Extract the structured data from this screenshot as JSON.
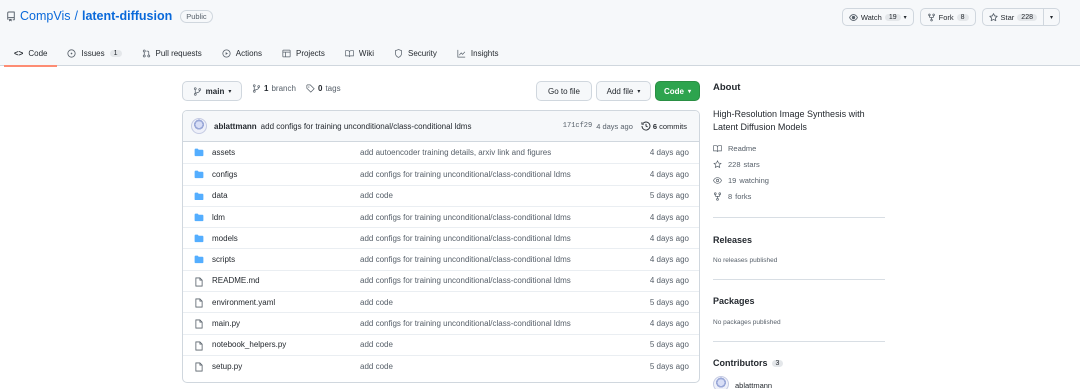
{
  "repo": {
    "owner": "CompVis",
    "separator": "/",
    "name": "latent-diffusion",
    "visibility": "Public",
    "watch_label": "Watch",
    "watch_count": "19",
    "fork_label": "Fork",
    "fork_count": "8",
    "star_label": "Star",
    "star_count": "228"
  },
  "tabs": [
    {
      "label": "Code",
      "icon": "code-icon",
      "active": true
    },
    {
      "label": "Issues",
      "count": "1",
      "icon": "issue-icon"
    },
    {
      "label": "Pull requests",
      "icon": "pull-request-icon"
    },
    {
      "label": "Actions",
      "icon": "play-icon"
    },
    {
      "label": "Projects",
      "icon": "table-icon"
    },
    {
      "label": "Wiki",
      "icon": "book-icon"
    },
    {
      "label": "Security",
      "icon": "shield-icon"
    },
    {
      "label": "Insights",
      "icon": "graph-icon"
    }
  ],
  "toolbar": {
    "branch": "main",
    "branch_count": "1",
    "branch_word": "branch",
    "tag_count": "0",
    "tag_word": "tags",
    "go_to_file": "Go to file",
    "add_file": "Add file",
    "code_button": "Code"
  },
  "commit": {
    "author": "ablattmann",
    "message": "add configs for training unconditional/class-conditional ldms",
    "sha": "171cf29",
    "age": "4 days ago",
    "count": "6",
    "count_word": "commits"
  },
  "files": [
    {
      "type": "folder",
      "name": "assets",
      "message": "add autoencoder training details, arxiv link and figures",
      "age": "4 days ago"
    },
    {
      "type": "folder",
      "name": "configs",
      "message": "add configs for training unconditional/class-conditional ldms",
      "age": "4 days ago"
    },
    {
      "type": "folder",
      "name": "data",
      "message": "add code",
      "age": "5 days ago"
    },
    {
      "type": "folder",
      "name": "ldm",
      "message": "add configs for training unconditional/class-conditional ldms",
      "age": "4 days ago"
    },
    {
      "type": "folder",
      "name": "models",
      "message": "add configs for training unconditional/class-conditional ldms",
      "age": "4 days ago"
    },
    {
      "type": "folder",
      "name": "scripts",
      "message": "add configs for training unconditional/class-conditional ldms",
      "age": "4 days ago"
    },
    {
      "type": "file",
      "name": "README.md",
      "message": "add configs for training unconditional/class-conditional ldms",
      "age": "4 days ago"
    },
    {
      "type": "file",
      "name": "environment.yaml",
      "message": "add code",
      "age": "5 days ago"
    },
    {
      "type": "file",
      "name": "main.py",
      "message": "add configs for training unconditional/class-conditional ldms",
      "age": "4 days ago"
    },
    {
      "type": "file",
      "name": "notebook_helpers.py",
      "message": "add code",
      "age": "5 days ago"
    },
    {
      "type": "file",
      "name": "setup.py",
      "message": "add code",
      "age": "5 days ago"
    }
  ],
  "about": {
    "title": "About",
    "description": "High-Resolution Image Synthesis with Latent Diffusion Models",
    "readme": "Readme",
    "stars_count": "228",
    "stars_word": "stars",
    "watching_count": "19",
    "watching_word": "watching",
    "forks_count": "8",
    "forks_word": "forks"
  },
  "releases": {
    "title": "Releases",
    "note": "No releases published"
  },
  "packages": {
    "title": "Packages",
    "note": "No packages published"
  },
  "contributors": {
    "title": "Contributors",
    "count": "3",
    "first": "ablattmann"
  },
  "colors": {
    "accent": "#0969da",
    "green": "#2da44e",
    "tab_underline": "#fd8c73",
    "folder": "#54aeff"
  }
}
